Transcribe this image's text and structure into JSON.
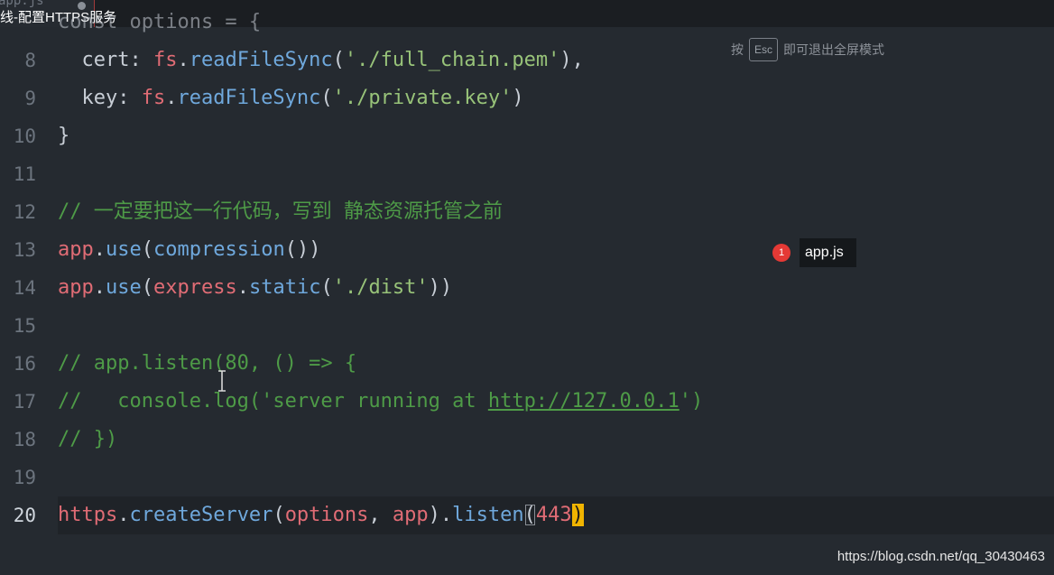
{
  "tab": {
    "filename": "app.js"
  },
  "overlay": {
    "video_title": "线-配置HTTPS服务",
    "esc_hint_prefix": "按",
    "esc_key": "Esc",
    "esc_hint_suffix": "即可退出全屏模式",
    "notification_count": "1",
    "notification_text": "app.js",
    "watermark": "https://blog.csdn.net/qq_30430463"
  },
  "editor": {
    "partial_line": "const options = {",
    "line_numbers": [
      "8",
      "9",
      "10",
      "11",
      "12",
      "13",
      "14",
      "15",
      "16",
      "17",
      "18",
      "19",
      "20"
    ],
    "active_line": "20",
    "lines": {
      "l8": {
        "p1": "  cert: ",
        "fs": "fs",
        "dot": ".",
        "fn": "readFileSync",
        "o": "(",
        "s": "'./full_chain.pem'",
        "c": "),"
      },
      "l9": {
        "p1": "  key: ",
        "fs": "fs",
        "dot": ".",
        "fn": "readFileSync",
        "o": "(",
        "s": "'./private.key'",
        "c": ")"
      },
      "l10": "}",
      "l12": "// 一定要把这一行代码，写到 静态资源托管之前",
      "l13": {
        "app": "app",
        "dot": ".",
        "use": "use",
        "o": "(",
        "fn": "compression",
        "c": "())"
      },
      "l14": {
        "app": "app",
        "dot": ".",
        "use": "use",
        "o": "(",
        "ex": "express",
        "dot2": ".",
        "st": "static",
        "o2": "(",
        "s": "'./dist'",
        "c": "))"
      },
      "l16": "// app.listen(80, () => {",
      "l17a": "//   console.log('server running at ",
      "l17b": "http://127.0.0.1",
      "l17c": "')",
      "l18": "// })",
      "l20": {
        "https": "https",
        "dot": ".",
        "cs": "createServer",
        "o": "(",
        "opt": "options",
        "comma": ", ",
        "app": "app",
        "c": ").",
        "listen": "listen",
        "bo": "(",
        "num": "443",
        "bc": ")"
      }
    }
  },
  "colors": {
    "background": "#252a30",
    "keyword": "#e06c75",
    "function": "#6fa8dc",
    "string": "#98c379",
    "comment": "#4e9b47",
    "cursor": "#f0b400",
    "badge": "#e53935"
  }
}
